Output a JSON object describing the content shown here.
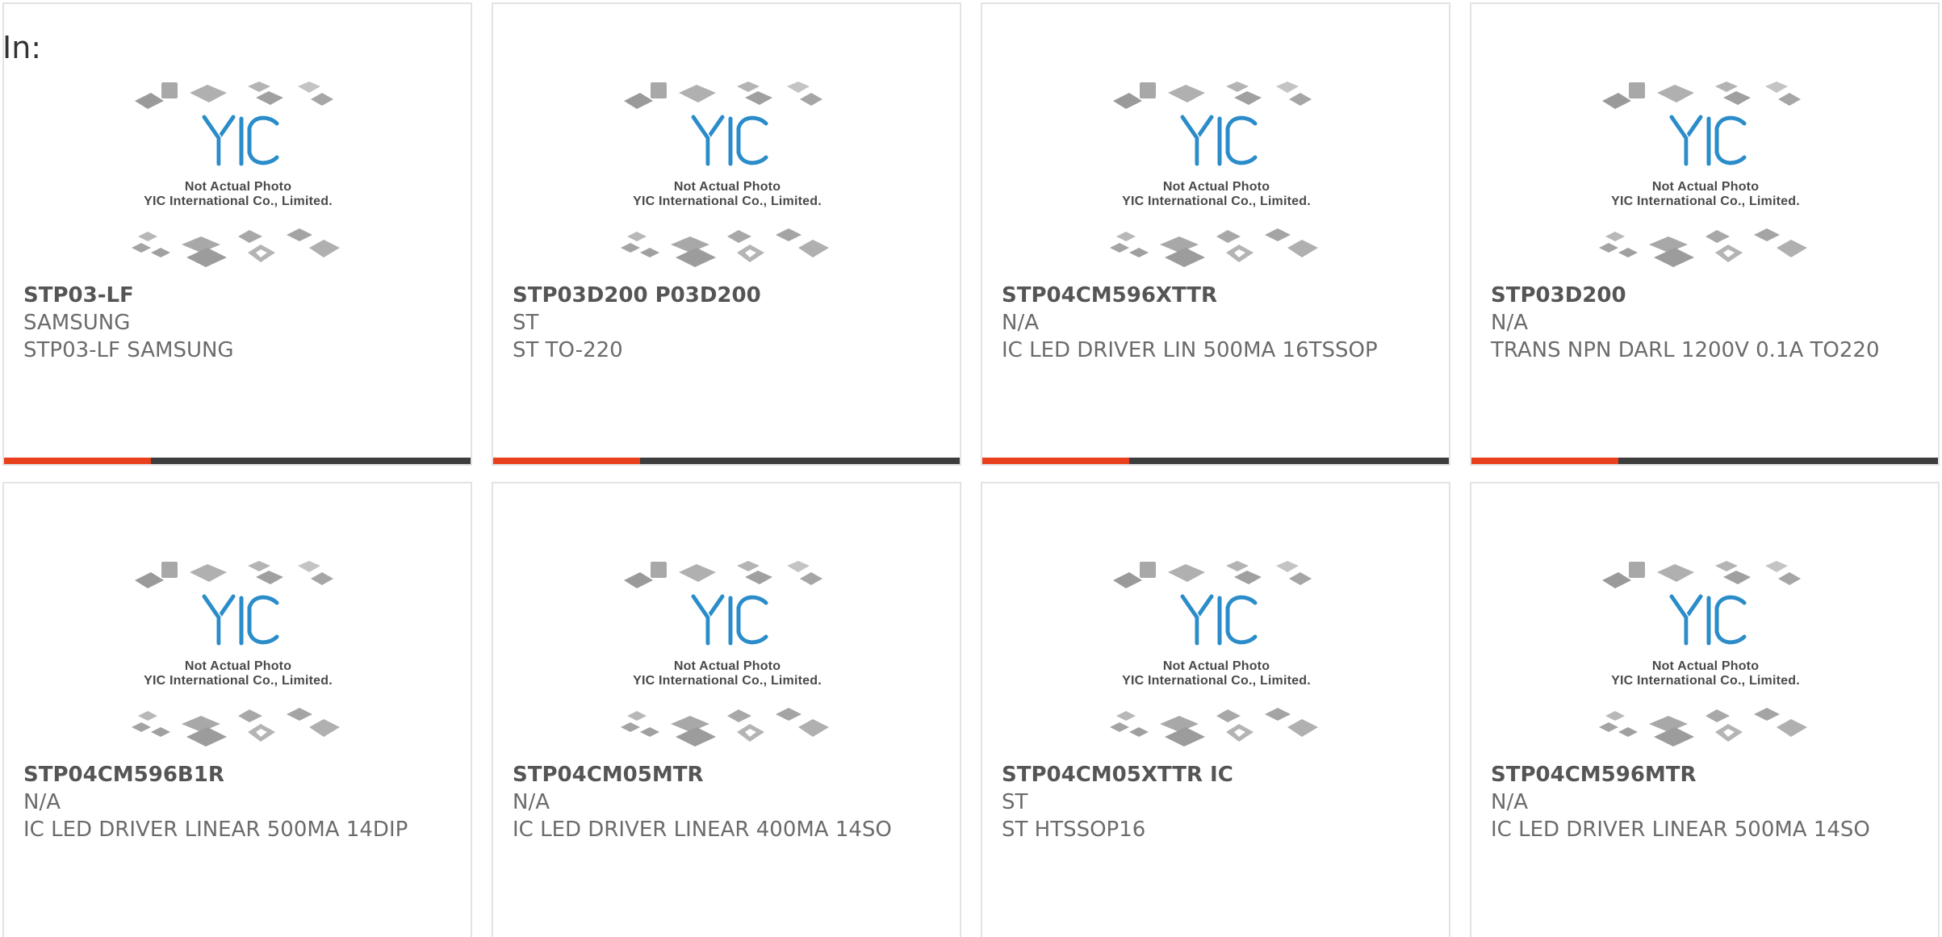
{
  "header": {
    "label": "In:"
  },
  "placeholder": {
    "line1": "Not Actual Photo",
    "line2": "YIC International Co., Limited.",
    "logo_text": "YIC",
    "logo_color": "#2a8cc9"
  },
  "colors": {
    "accent": "#e8401c",
    "bar": "#3d3d3d",
    "border": "#e3e3e3",
    "text": "#6b6b6b"
  },
  "products": [
    {
      "part": "STP03-LF",
      "maker": "SAMSUNG",
      "desc": "STP03-LF SAMSUNG"
    },
    {
      "part": "STP03D200 P03D200",
      "maker": "ST",
      "desc": "ST TO-220"
    },
    {
      "part": "STP04CM596XTTR",
      "maker": "N/A",
      "desc": "IC LED DRIVER LIN 500MA 16TSSOP"
    },
    {
      "part": "STP03D200",
      "maker": "N/A",
      "desc": "TRANS NPN DARL 1200V 0.1A TO220"
    },
    {
      "part": "STP04CM596B1R",
      "maker": "N/A",
      "desc": "IC LED DRIVER LINEAR 500MA 14DIP"
    },
    {
      "part": "STP04CM05MTR",
      "maker": "N/A",
      "desc": "IC LED DRIVER LINEAR 400MA 14SO"
    },
    {
      "part": "STP04CM05XTTR IC",
      "maker": "ST",
      "desc": "ST HTSSOP16"
    },
    {
      "part": "STP04CM596MTR",
      "maker": "N/A",
      "desc": "IC LED DRIVER LINEAR 500MA 14SO"
    }
  ]
}
